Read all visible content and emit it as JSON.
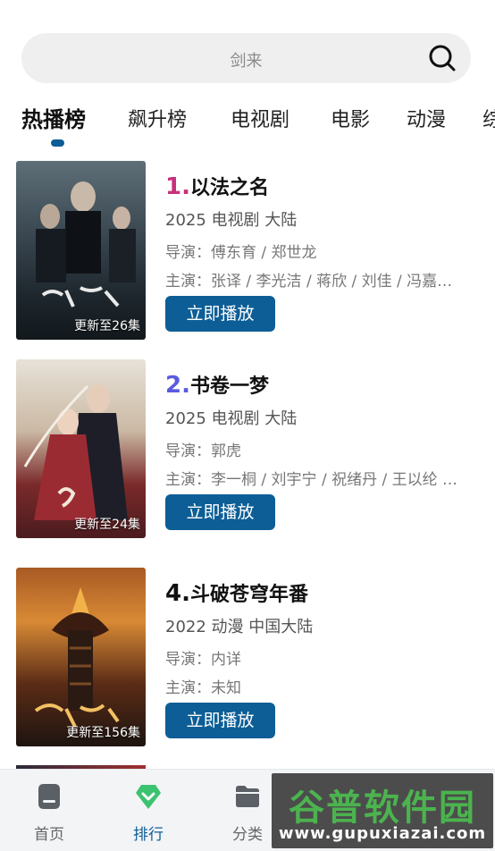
{
  "search": {
    "placeholder": "剑来"
  },
  "tabs": [
    {
      "label": "热播榜"
    },
    {
      "label": "飙升榜"
    },
    {
      "label": "电视剧"
    },
    {
      "label": "电影"
    },
    {
      "label": "动漫"
    },
    {
      "label": "综"
    }
  ],
  "items": [
    {
      "rank": "1.",
      "rank_color": "#c8307c",
      "title": "以法之名",
      "meta": "2025  电视剧  大陆",
      "director": "导演：傅东育 / 郑世龙",
      "cast": "主演：张译 / 李光洁 / 蒋欣 / 刘佳 / 冯嘉…",
      "poster_caption": "更新至26集",
      "button": "立即播放"
    },
    {
      "rank": "2.",
      "rank_color": "#5a5ae0",
      "title": "书卷一梦",
      "meta": "2025  电视剧  大陆",
      "director": "导演：郭虎",
      "cast": "主演：李一桐 / 刘宇宁 / 祝绪丹 / 王以纶 …",
      "poster_caption": "更新至24集",
      "button": "立即播放"
    },
    {
      "rank": "4.",
      "rank_color": "#111111",
      "title": "斗破苍穹年番",
      "meta": "2022  动漫  中国大陆",
      "director": "导演：内详",
      "cast": "主演：未知",
      "poster_caption": "更新至156集",
      "button": "立即播放"
    }
  ],
  "bottom_nav": [
    {
      "label": "首页",
      "icon": "home-icon"
    },
    {
      "label": "排行",
      "icon": "rank-diamond-icon"
    },
    {
      "label": "分类",
      "icon": "folder-icon"
    }
  ],
  "watermark": {
    "title": "谷普软件园",
    "url": "www.gupuxiazai.com"
  },
  "colors": {
    "accent": "#0d5e96",
    "rank_tab_green": "#3cc36f"
  }
}
